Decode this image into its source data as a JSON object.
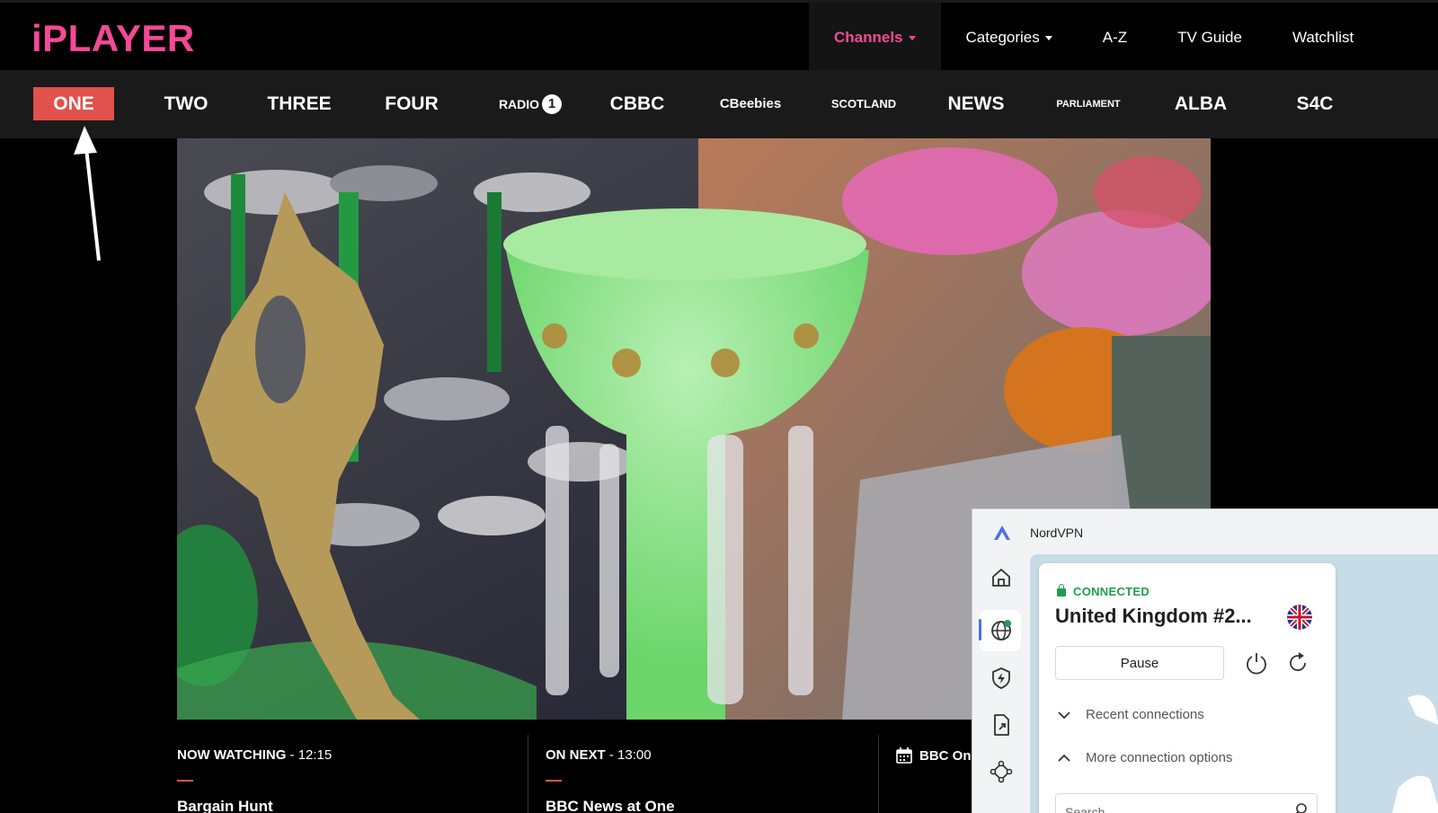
{
  "header": {
    "logo": "iPLAYER",
    "nav": [
      {
        "label": "Channels",
        "active": true,
        "dropdown": true
      },
      {
        "label": "Categories",
        "active": false,
        "dropdown": true
      },
      {
        "label": "A-Z",
        "active": false,
        "dropdown": false
      },
      {
        "label": "TV Guide",
        "active": false,
        "dropdown": false
      },
      {
        "label": "Watchlist",
        "active": false,
        "dropdown": false
      }
    ]
  },
  "channels": [
    {
      "label": "ONE",
      "active": true
    },
    {
      "label": "TWO"
    },
    {
      "label": "THREE"
    },
    {
      "label": "FOUR"
    },
    {
      "label": "RADIO",
      "badge": "1"
    },
    {
      "label": "CBBC"
    },
    {
      "label": "CBeebies"
    },
    {
      "label": "SCOTLAND"
    },
    {
      "label": "NEWS"
    },
    {
      "label": "PARLIAMENT"
    },
    {
      "label": "ALBA"
    },
    {
      "label": "S4C"
    }
  ],
  "info": {
    "now_label": "NOW WATCHING",
    "now_time": " - 12:15",
    "now_title": "Bargain Hunt",
    "next_label": "ON NEXT",
    "next_time": " - 13:00",
    "next_title": "BBC News at One",
    "schedule_label": "BBC On"
  },
  "vpn": {
    "app_name": "NordVPN",
    "status": "CONNECTED",
    "server": "United Kingdom #2...",
    "pause_label": "Pause",
    "recent_label": "Recent connections",
    "more_label": "More connection options",
    "search_placeholder": "Search",
    "colors": {
      "connected": "#1f9e4e",
      "accent": "#4a6fe8"
    }
  },
  "colors": {
    "brand": "#f54997",
    "active_channel": "#e0524b"
  }
}
